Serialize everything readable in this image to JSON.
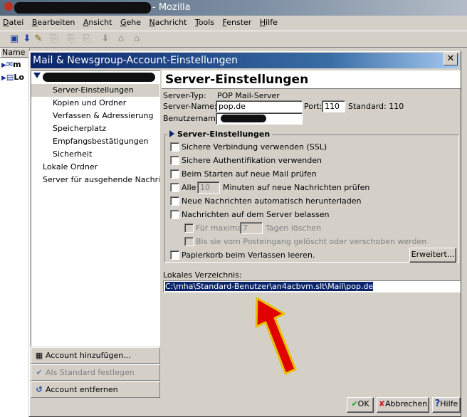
{
  "background_window": {
    "title": "- Mozilla",
    "menu": [
      "Datei",
      "Bearbeiten",
      "Ansicht",
      "Gehe",
      "Nachricht",
      "Tools",
      "Fenster",
      "Hilfe"
    ],
    "folder_column_header": "Name",
    "folder_rows": [
      "m",
      "Lo"
    ]
  },
  "dialog": {
    "title": "Mail & Newsgroup-Account-Einstellungen",
    "close_glyph": "✕",
    "tree": {
      "items": [
        {
          "label": "Server-Einstellungen"
        },
        {
          "label": "Kopien und Ordner"
        },
        {
          "label": "Verfassen & Adressierung"
        },
        {
          "label": "Speicherplatz"
        },
        {
          "label": "Empfangsbestätigungen"
        },
        {
          "label": "Sicherheit"
        }
      ],
      "local_folders": "Lokale Ordner",
      "outgoing_server": "Server für ausgehende Nachric..."
    },
    "buttons": {
      "add_account": "Account hinzufügen...",
      "set_default": "Als Standard festlegen",
      "remove_account": "Account entfernen",
      "ok": "OK",
      "cancel": "Abbrechen",
      "help": "Hilfe"
    },
    "page": {
      "title": "Server-Einstellungen",
      "server_type_label": "Server-Typ:",
      "server_type_value": "POP Mail-Server",
      "server_name_label": "Server-Name:",
      "server_name_value": "pop.de",
      "port_label": "Port:",
      "port_value": "110",
      "standard_label": "Standard: 110",
      "username_label": "Benutzername:",
      "group_title": "Server-Einstellungen",
      "ssl_label": "Sichere Verbindung verwenden (SSL)",
      "secure_auth_label": "Sichere Authentifikation verwenden",
      "check_on_start_label": "Beim Starten auf neue Mail prüfen",
      "every_label": "Alle",
      "minutes_value": "10",
      "minutes_suffix": "Minuten auf neue Nachrichten prüfen",
      "auto_download_label": "Neue Nachrichten automatisch herunterladen",
      "leave_on_server_label": "Nachrichten auf dem Server belassen",
      "max_days_label": "Für maximal",
      "days_value": "7",
      "days_suffix": "Tagen löschen",
      "until_deleted_label": "Bis sie vom Posteingang gelöscht oder verschoben werden",
      "empty_trash_label": "Papierkorb beim Verlassen leeren.",
      "advanced_button": "Erweitert...",
      "local_dir_label": "Lokales Verzeichnis:",
      "local_dir_value": "C:\\mha\\Standard-Benutzer\\an4acbvm.slt\\Mail\\pop.de"
    }
  }
}
